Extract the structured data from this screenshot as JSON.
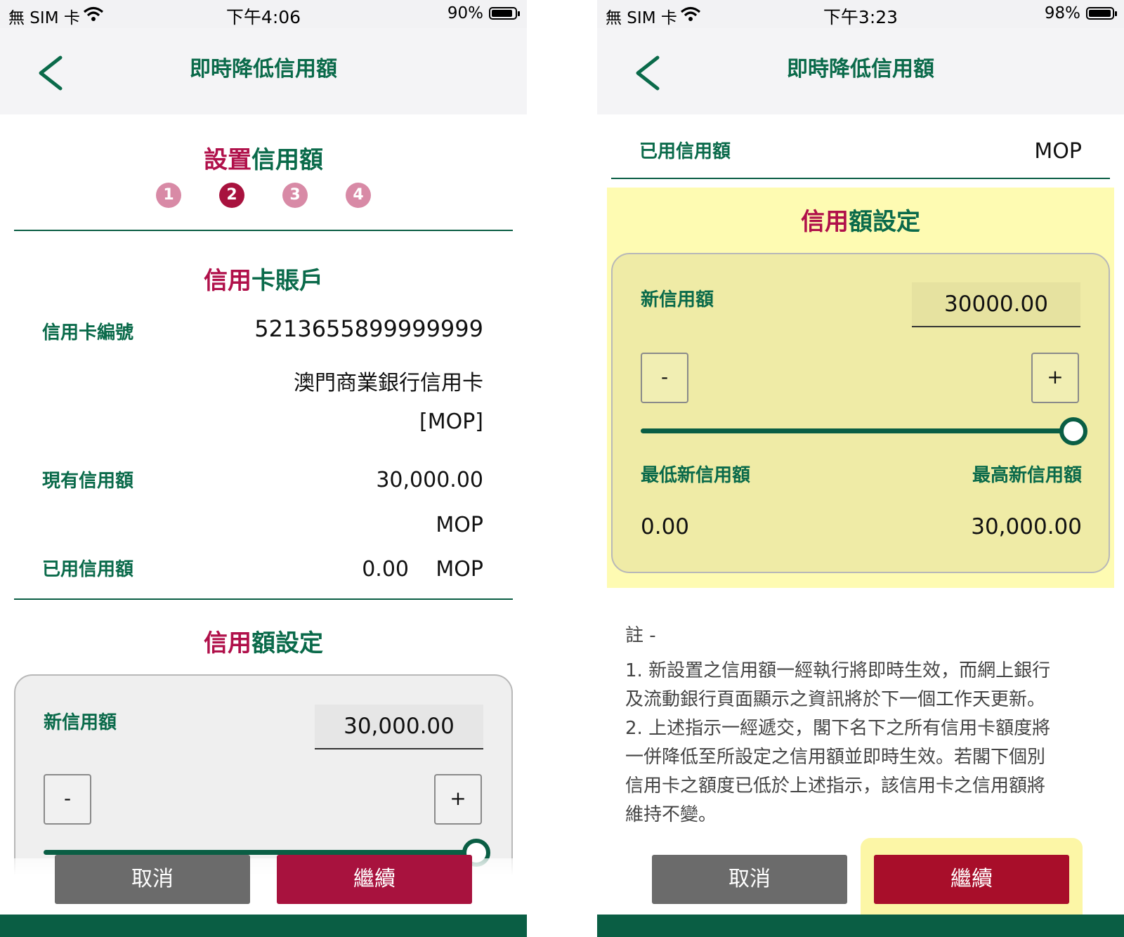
{
  "left": {
    "status": {
      "carrier": "無 SIM 卡",
      "time": "下午4:06",
      "battery": "90%",
      "battery_level": 0.9
    },
    "nav_title": "即時降低信用額",
    "section_setup": {
      "title_part1": "設置",
      "title_part2": "信用額",
      "steps": [
        "1",
        "2",
        "3",
        "4"
      ],
      "active_step": 2
    },
    "section_account": {
      "title_part1": "信用",
      "title_part2": "卡賬戶"
    },
    "card_number_label": "信用卡編號",
    "card_number": "5213655899999999",
    "card_name": "澳門商業銀行信用卡",
    "card_currency": "[MOP]",
    "current_limit_label": "現有信用額",
    "current_limit": "30,000.00",
    "current_limit_currency": "MOP",
    "used_label": "已用信用額",
    "used_value": "0.00",
    "used_currency": "MOP",
    "section_limit": {
      "title_part1": "信用",
      "title_part2": "額設定"
    },
    "new_limit_label": "新信用額",
    "new_limit_value": "30,000.00",
    "minus": "-",
    "plus": "+",
    "slider_level": 1.0,
    "cancel": "取消",
    "continue": "繼續"
  },
  "right": {
    "status": {
      "carrier": "無 SIM 卡",
      "time": "下午3:23",
      "battery": "98%",
      "battery_level": 0.98
    },
    "nav_title": "即時降低信用額",
    "used_label": "已用信用額",
    "used_currency": "MOP",
    "section_limit": {
      "title_part1": "信用",
      "title_part2": "額設定"
    },
    "new_limit_label": "新信用額",
    "new_limit_value": "30000.00",
    "minus": "-",
    "plus": "+",
    "slider_level": 1.0,
    "min_label": "最低新信用額",
    "max_label": "最高新信用額",
    "min_value": "0.00",
    "max_value": "30,000.00",
    "note_title": "註 -",
    "note_lines": [
      "1. 新設置之信用額一經執行將即時生效，而網上銀行",
      "及流動銀行頁面顯示之資訊將於下一個工作天更新。",
      "2. 上述指示一經遞交，閣下名下之所有信用卡額度將",
      "一併降低至所設定之信用額並即時生效。若閣下個別",
      "信用卡之額度已低於上述指示，該信用卡之信用額將",
      "維持不變。"
    ],
    "cancel": "取消",
    "continue": "繼續"
  }
}
